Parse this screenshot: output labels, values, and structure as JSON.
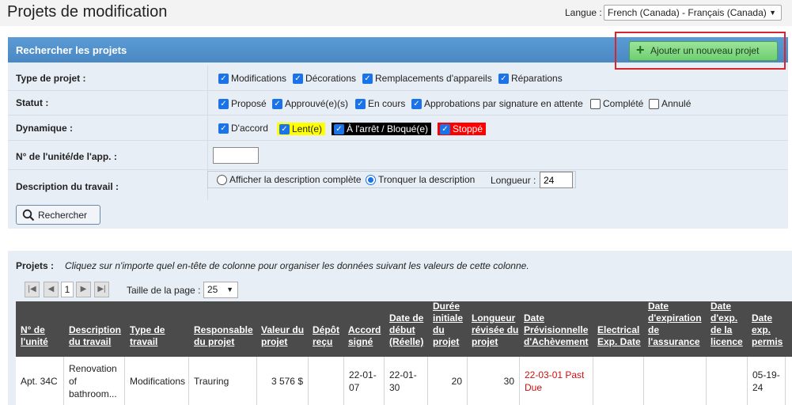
{
  "header": {
    "title": "Projets de modification",
    "language_label": "Langue :",
    "language_value": "French (Canada) - Français (Canada)"
  },
  "search": {
    "title": "Rechercher les projets",
    "add_button": "Ajouter un nouveau projet",
    "type_label": "Type de projet :",
    "types": [
      {
        "label": "Modifications",
        "checked": true
      },
      {
        "label": "Décorations",
        "checked": true
      },
      {
        "label": "Remplacements d'appareils",
        "checked": true
      },
      {
        "label": "Réparations",
        "checked": true
      }
    ],
    "status_label": "Statut :",
    "statuses": [
      {
        "label": "Proposé",
        "checked": true
      },
      {
        "label": "Approuvé(e)(s)",
        "checked": true
      },
      {
        "label": "En cours",
        "checked": true
      },
      {
        "label": "Approbations par signature en attente",
        "checked": true
      },
      {
        "label": "Complété",
        "checked": false
      },
      {
        "label": "Annulé",
        "checked": false
      }
    ],
    "dynamic_label": "Dynamique :",
    "dynamics": [
      {
        "label": "D'accord",
        "checked": true,
        "bg": "",
        "fg": "#222222"
      },
      {
        "label": "Lent(e)",
        "checked": true,
        "bg": "#ffff00",
        "fg": "#222222"
      },
      {
        "label": "À l'arrêt / Bloqué(e)",
        "checked": true,
        "bg": "#000000",
        "fg": "#ffffff"
      },
      {
        "label": "Stoppé",
        "checked": true,
        "bg": "#ff0000",
        "fg": "#ffffff"
      }
    ],
    "unit_label": "N° de l'unité/de l'app. :",
    "unit_value": "",
    "desc_label": "Description du travail :",
    "desc_full": "Afficher la description complète",
    "desc_trunc": "Tronquer la description",
    "length_label": "Longueur :",
    "length_value": "24",
    "search_button": "Rechercher"
  },
  "projects": {
    "label": "Projets :",
    "hint": "Cliquez sur n'importe quel en-tête de colonne pour organiser les données suivant les valeurs de cette colonne.",
    "current_page": "1",
    "page_size_label": "Taille de la page :",
    "page_size": "25",
    "columns": [
      "N° de l'unité",
      "Description du travail",
      "Type de travail",
      "Responsable du projet",
      "Valeur du projet",
      "Dépôt reçu",
      "Accord signé",
      "Date de début (Réelle)",
      "Durée initiale du projet",
      "Longueur révisée du projet",
      "Date Prévisionnelle d'Achèvement",
      "Electrical Exp. Date",
      "Date d'expiration de l'assurance",
      "Date d'exp. de la licence",
      "Date exp. permis"
    ],
    "row": {
      "unit": "Apt. 34C",
      "description": "Renovation of bathroom...",
      "type": "Modifications",
      "manager": "Trauring",
      "value": "3 576 $",
      "deposit": "",
      "signed": "22-01-07",
      "start": "22-01-30",
      "initial_duration": "20",
      "revised_length": "30",
      "forecast": "22-03-01 Past Due",
      "electrical": "",
      "insurance": "",
      "license": "",
      "permit": "05-19-24"
    }
  }
}
